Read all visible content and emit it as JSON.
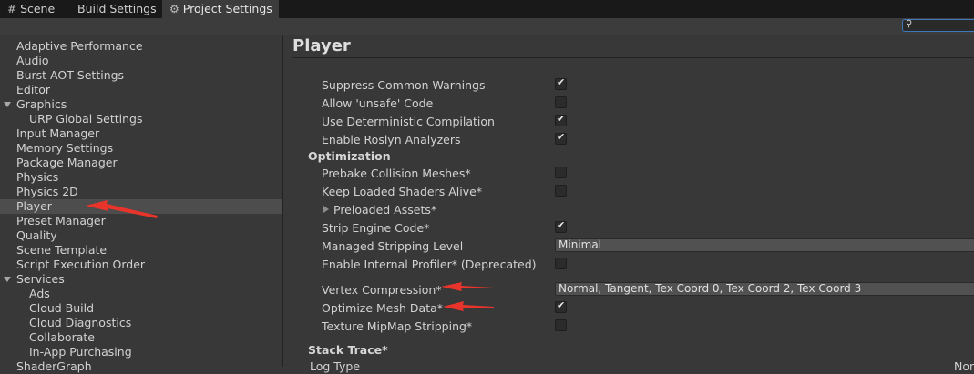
{
  "tabs": [
    {
      "label": "Scene",
      "icon": "grid-icon"
    },
    {
      "label": "Build Settings"
    },
    {
      "label": "Project Settings",
      "icon": "gear-icon",
      "active": true
    }
  ],
  "search": {
    "placeholder": ""
  },
  "sidebar": {
    "items": [
      {
        "label": "Adaptive Performance"
      },
      {
        "label": "Audio"
      },
      {
        "label": "Burst AOT Settings"
      },
      {
        "label": "Editor"
      },
      {
        "label": "Graphics",
        "expanded": true
      },
      {
        "label": "URP Global Settings"
      },
      {
        "label": "Input Manager"
      },
      {
        "label": "Memory Settings"
      },
      {
        "label": "Package Manager"
      },
      {
        "label": "Physics"
      },
      {
        "label": "Physics 2D"
      },
      {
        "label": "Player",
        "selected": true
      },
      {
        "label": "Preset Manager"
      },
      {
        "label": "Quality"
      },
      {
        "label": "Scene Template"
      },
      {
        "label": "Script Execution Order"
      },
      {
        "label": "Services",
        "expanded": true
      },
      {
        "label": "Ads"
      },
      {
        "label": "Cloud Build"
      },
      {
        "label": "Cloud Diagnostics"
      },
      {
        "label": "Collaborate"
      },
      {
        "label": "In-App Purchasing"
      },
      {
        "label": "ShaderGraph"
      }
    ]
  },
  "main": {
    "title": "Player",
    "rows": [
      {
        "label": "Suppress Common Warnings",
        "checked": true
      },
      {
        "label": "Allow 'unsafe' Code",
        "checked": false
      },
      {
        "label": "Use Deterministic Compilation",
        "checked": true
      },
      {
        "label": "Enable Roslyn Analyzers",
        "checked": true
      }
    ],
    "optimization": {
      "header": "Optimization",
      "prebake": {
        "label": "Prebake Collision Meshes*",
        "checked": false
      },
      "keep_shaders": {
        "label": "Keep Loaded Shaders Alive*",
        "checked": false
      },
      "preloaded": {
        "label": "Preloaded Assets*"
      },
      "strip_engine": {
        "label": "Strip Engine Code*",
        "checked": true
      },
      "managed_stripping": {
        "label": "Managed Stripping Level",
        "value": "Minimal"
      },
      "internal_profiler": {
        "label": "Enable Internal Profiler* (Deprecated)",
        "checked": false
      },
      "vertex_compression": {
        "label": "Vertex Compression*",
        "value": "Normal, Tangent, Tex Coord 0, Tex Coord 2, Tex Coord 3"
      },
      "optimize_mesh": {
        "label": "Optimize Mesh Data*",
        "checked": true
      },
      "mipmap_stripping": {
        "label": "Texture MipMap Stripping*",
        "checked": false
      }
    },
    "stack_trace": {
      "header": "Stack Trace*",
      "log_type": "Log Type",
      "col_none": "None"
    }
  },
  "annotation_color": "#e8342a",
  "check_glyph": "✔"
}
